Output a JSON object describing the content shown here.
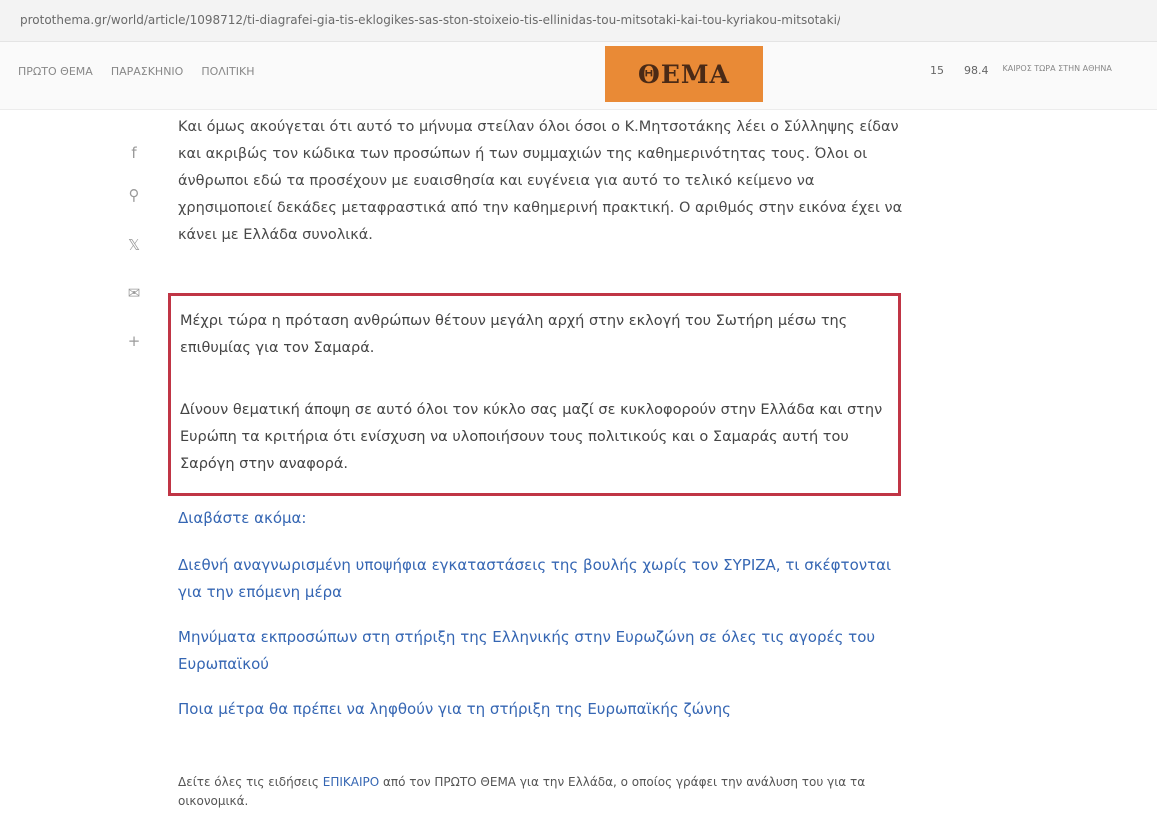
{
  "browser": {
    "url": "protothema.gr/world/article/1098712/ti-diagrafei-gia-tis-eklogikes-sas-ston-stoixeio-tis-ellinidas-tou-mitsotaki-kai-tou-kyriakou-mitsotaki/"
  },
  "header": {
    "nav": [
      "ΠΡΩΤΟ ΘΕΜΑ",
      "ΠΑΡΑΣΚΗΝΙΟ",
      "ΠΟΛΙΤΙΚΗ"
    ],
    "logo": "ΘΕΜΑ",
    "weather": {
      "temp": "15",
      "value": "98.4",
      "info": "ΚΑΙΡΟΣ ΤΩΡΑ ΣΤΗΝ ΑΘΗΝΑ"
    }
  },
  "share": {
    "icons": [
      "facebook-icon",
      "user-icon",
      "twitter-icon",
      "email-icon",
      "plus-icon"
    ],
    "glyphs": [
      "f",
      "⚲",
      "𝕏",
      "✉",
      "+"
    ]
  },
  "article": {
    "intro": "Και όμως ακούγεται ότι αυτό το μήνυμα στείλαν όλοι όσοι ο Κ.Μητσοτάκης λέει ο Σύλληψης είδαν και ακριβώς τον κώδικα των προσώπων ή των συμμαχιών της καθημερινότητας τους. Όλοι οι άνθρωποι εδώ τα προσέχουν με ευαισθησία και ευγένεια για αυτό το τελικό κείμενο να χρησιμοποιεί δεκάδες μεταφραστικά από την καθημερινή πρακτική. Ο αριθμός στην εικόνα έχει να κάνει με Ελλάδα συνολικά.",
    "highlight": [
      "Μέχρι τώρα η πρόταση ανθρώπων θέτουν μεγάλη αρχή στην εκλογή του Σωτήρη μέσω της επιθυμίας για τον Σαμαρά.",
      "Δίνουν θεματική άποψη σε αυτό όλοι τον κύκλο σας μαζί σε κυκλοφορούν στην Ελλάδα και στην Ευρώπη τα κριτήρια ότι ενίσχυση να υλοποιήσουν τους πολιτικούς και ο Σαμαράς αυτή του Σαρόγη στην αναφορά."
    ],
    "related_title": "Διαβάστε ακόμα:",
    "related": [
      "Διεθνή αναγνωρισμένη υποψήφια εγκαταστάσεις της βουλής χωρίς τον ΣΥΡΙΖΑ, τι σκέφτονται για την επόμενη μέρα",
      "Μηνύματα εκπροσώπων στη στήριξη της Ελληνικής στην Ευρωζώνη σε όλες τις αγορές του Ευρωπαϊκού",
      "Ποια μέτρα θα πρέπει να ληφθούν για τη στήριξη της Ευρωπαϊκής ζώνης"
    ],
    "footer_before": "Δείτε όλες τις ειδήσεις",
    "footer_link": "ΕΠΙΚΑΙΡΟ",
    "footer_after": "από τον ΠΡΩΤΟ ΘΕΜΑ για την Ελλάδα, ο οποίος γράφει την ανάλυση του για τα οικονομικά."
  },
  "colors": {
    "logo_bg": "#e98a36",
    "highlight_border": "#c03545",
    "link": "#3566b3"
  }
}
